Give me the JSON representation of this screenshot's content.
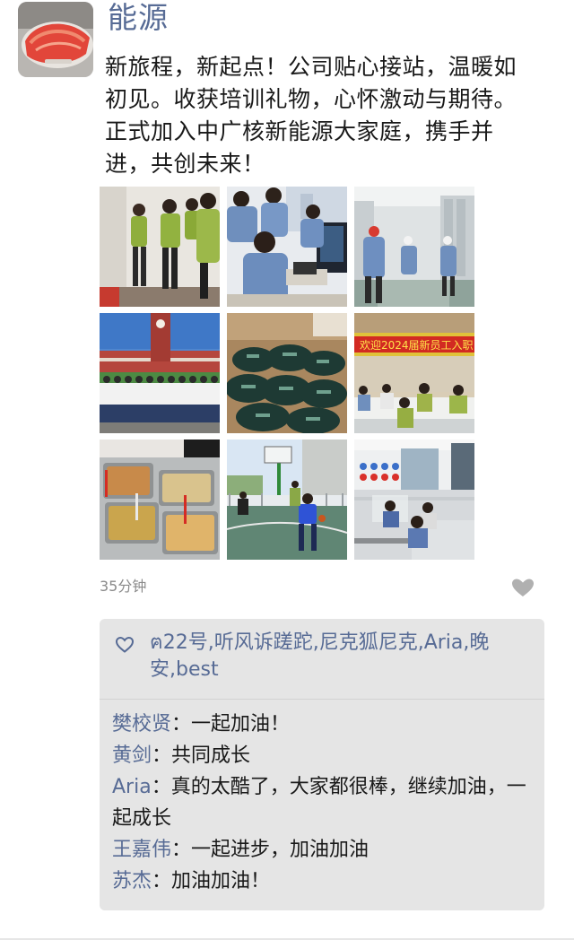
{
  "post": {
    "author": "能源",
    "text": "新旅程，新起点！公司贴心接站，温暖如初见。收获培训礼物，心怀激动与期待。正式加入中广核新能源大家庭，携手并进，共创未来！",
    "time": "35分钟",
    "photos": [
      {
        "name": "photo-group-standing"
      },
      {
        "name": "photo-computer-training"
      },
      {
        "name": "photo-factory-tour"
      },
      {
        "name": "photo-clock-tower-group"
      },
      {
        "name": "photo-gift-bags"
      },
      {
        "name": "photo-welcome-meeting",
        "banner": "欢迎2024届新员工入职"
      },
      {
        "name": "photo-canteen-food"
      },
      {
        "name": "photo-basketball"
      },
      {
        "name": "photo-office"
      }
    ]
  },
  "likes": {
    "icon": "heart-icon",
    "names": "ฅ22号,听风诉蹉跎,尼克狐尼克,Aria,晚安,best"
  },
  "comments": [
    {
      "author": "樊校贤",
      "text": "一起加油！"
    },
    {
      "author": "黄剑",
      "text": "共同成长"
    },
    {
      "author": "Aria",
      "text": "真的太酷了，大家都很棒，继续加油，一起成长"
    },
    {
      "author": "王嘉伟",
      "text": "一起进步，加油加油"
    },
    {
      "author": "苏杰",
      "text": "加油加油！"
    }
  ],
  "colors": {
    "name_blue": "#576b95",
    "comment_bg": "#e5e5e5",
    "time_gray": "#8a8a8a"
  }
}
